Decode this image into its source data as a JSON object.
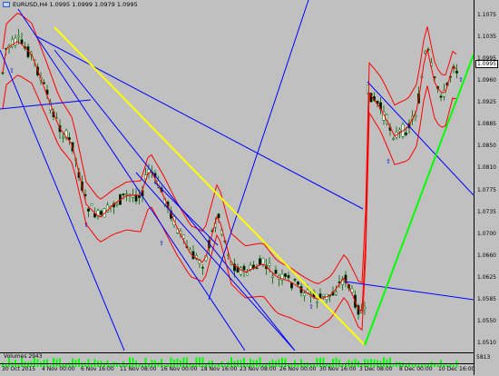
{
  "chart": {
    "symbol_title": "EURUSD,H4",
    "ohlc": "1.0995 1.0999 1.0979 1.0995",
    "current_price": "1.0995",
    "price_labels": [
      "1.1075",
      "1.1035",
      "1.0995",
      "1.0960",
      "1.0925",
      "1.0885",
      "1.0850",
      "1.0810",
      "1.0775",
      "1.0735",
      "1.0700",
      "1.0660",
      "1.0625",
      "1.0585",
      "1.0550",
      "1.0510"
    ],
    "time_labels": [
      "30 Oct 2015",
      "4 Nov 00:00",
      "6 Nov 16:00",
      "11 Nov 08:00",
      "16 Nov 00:00",
      "18 Nov 16:00",
      "23 Nov 08:00",
      "26 Nov 00:00",
      "30 Nov 16:00",
      "3 Dec 08:00",
      "8 Dec 00:00",
      "10 Dec 16:00"
    ],
    "volumes_label": "Volumes 2943",
    "volumes_scale": "5813",
    "colors": {
      "background": "#c0c0c0",
      "candles": "#006400",
      "bollinger": "#ff0000",
      "channel": "#0000ff",
      "trend_yellow": "#ffff00",
      "trend_green": "#00ff00",
      "volume": "#00ff00"
    }
  }
}
